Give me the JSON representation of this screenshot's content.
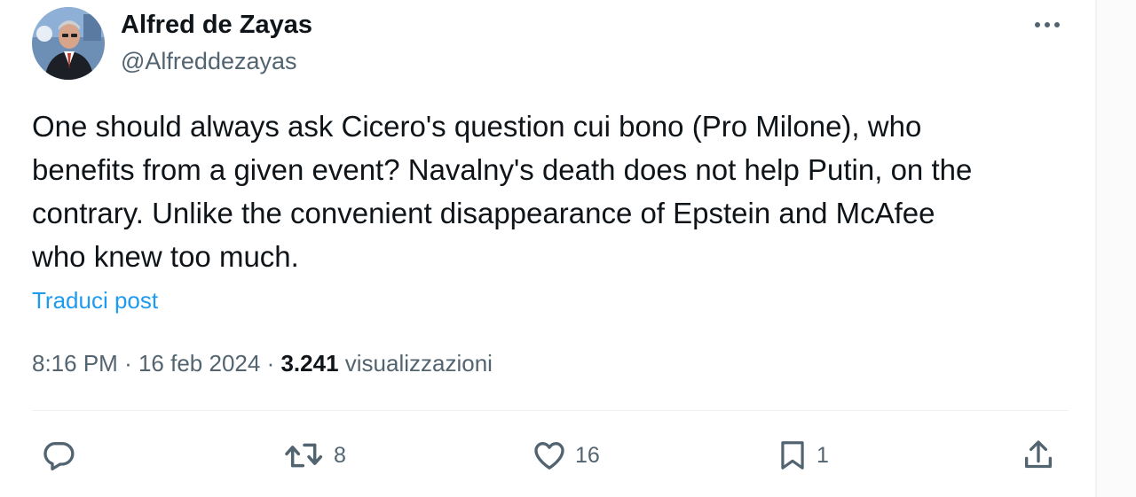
{
  "author": {
    "display_name": "Alfred de Zayas",
    "handle": "@Alfreddezayas"
  },
  "tweet": {
    "lines": [
      "One should always ask Cicero's question cui bono (Pro Milone), who",
      "benefits from a given event?  Navalny's death does not help Putin, on the",
      "contrary. Unlike the convenient disappearance of Epstein and McAfee",
      "who knew too much."
    ],
    "translate_label": "Traduci post"
  },
  "meta": {
    "time": "8:16 PM",
    "separator": "·",
    "date": "16 feb 2024",
    "views_count": "3.241",
    "views_label": "visualizzazioni"
  },
  "actions": {
    "reply": {
      "icon": "reply-icon",
      "count": ""
    },
    "repost": {
      "icon": "repost-icon",
      "count": "8"
    },
    "like": {
      "icon": "heart-icon",
      "count": "16"
    },
    "bookmark": {
      "icon": "bookmark-icon",
      "count": "1"
    },
    "share": {
      "icon": "share-icon",
      "count": ""
    }
  },
  "colors": {
    "text_primary": "#0f1419",
    "text_secondary": "#536471",
    "link": "#1d9bf0",
    "divider": "#eff3f4"
  }
}
